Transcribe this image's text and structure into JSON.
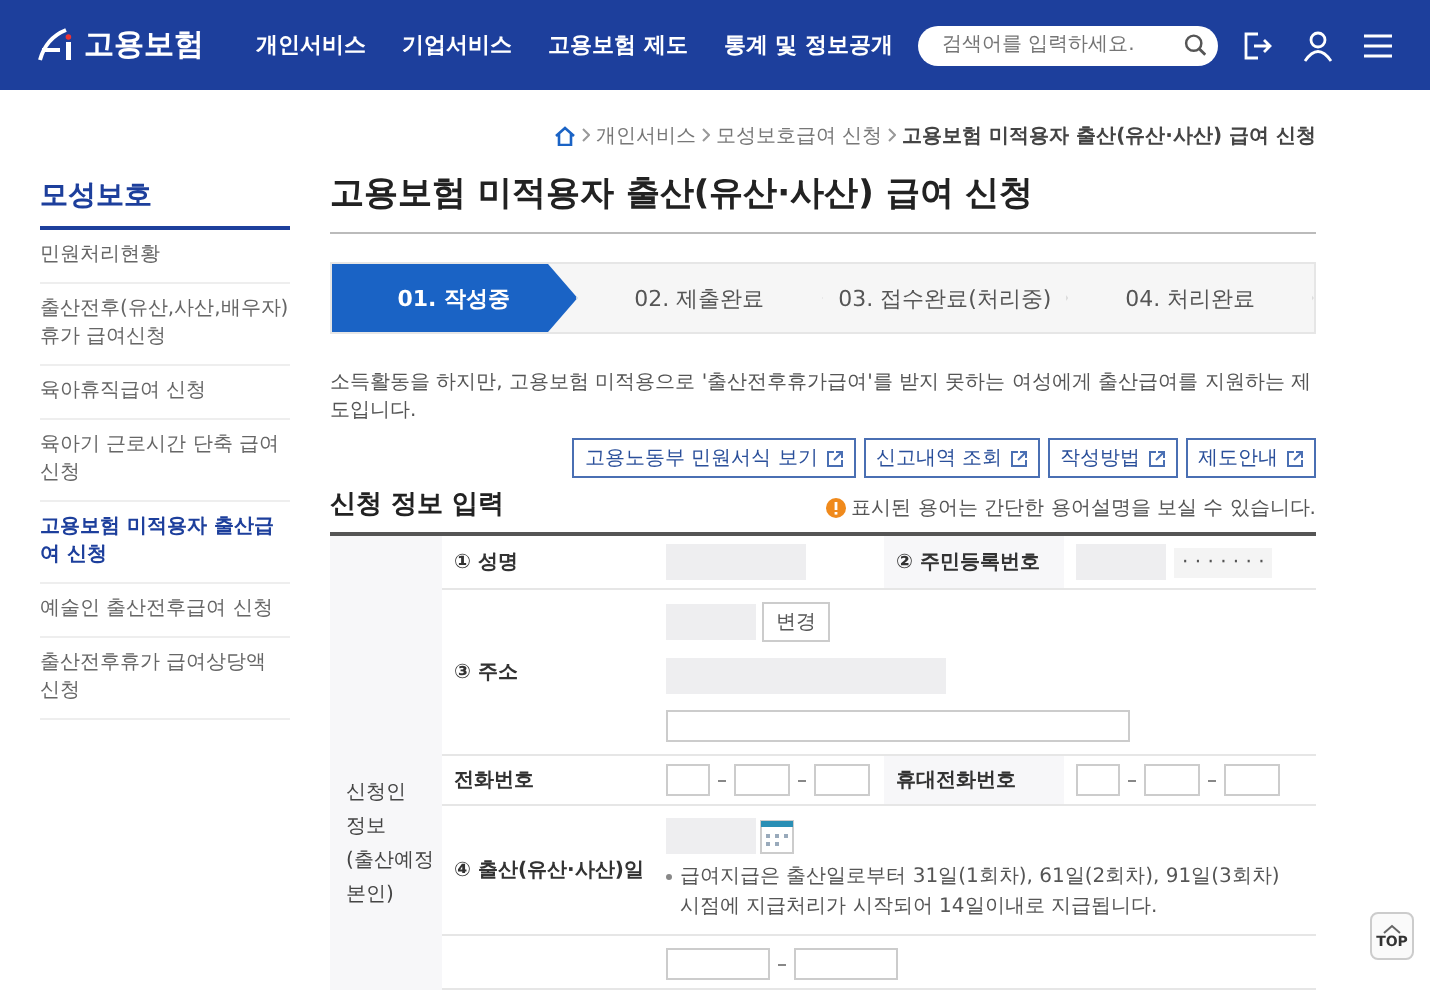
{
  "header": {
    "logo_text": "고용보험",
    "nav": [
      "개인서비스",
      "기업서비스",
      "고용보험 제도",
      "통계 및 정보공개"
    ],
    "search": {
      "placeholder": "검색어를 입력하세요."
    }
  },
  "breadcrumb": [
    "개인서비스",
    "모성보호급여 신청",
    "고용보험 미적용자 출산(유산·사산) 급여 신청"
  ],
  "sidebar": {
    "title": "모성보호",
    "items": [
      {
        "label": "민원처리현황",
        "selected": false
      },
      {
        "label": "출산전후(유산,사산,배우자)휴가 급여신청",
        "selected": false
      },
      {
        "label": "육아휴직급여 신청",
        "selected": false
      },
      {
        "label": "육아기 근로시간 단축 급여신청",
        "selected": false
      },
      {
        "label": "고용보험 미적용자 출산급여 신청",
        "selected": true
      },
      {
        "label": "예술인 출산전후급여 신청",
        "selected": false
      },
      {
        "label": "출산전후휴가 급여상당액 신청",
        "selected": false
      }
    ]
  },
  "page_title": "고용보험 미적용자 출산(유산·사산) 급여 신청",
  "steps": [
    {
      "label": "01. 작성중",
      "selected": true
    },
    {
      "label": "02. 제출완료",
      "selected": false
    },
    {
      "label": "03. 접수완료(처리중)",
      "selected": false
    },
    {
      "label": "04. 처리완료",
      "selected": false
    }
  ],
  "description": "소득활동을 하지만, 고용보험 미적용으로 '출산전후휴가급여'를 받지 못하는 여성에게 출산급여를 지원하는 제도입니다.",
  "link_buttons": [
    "고용노동부 민원서식 보기",
    "신고내역 조회",
    "작성방법",
    "제도안내"
  ],
  "section_title": "신청 정보 입력",
  "notice": "표시된 용어는 간단한 용어설명을 보실 수 있습니다.",
  "form": {
    "group_label": "신청인 정보 (출산예정 본인)",
    "name_label": "① 성명",
    "rrn_label": "② 주민등록번호",
    "rrn_mask": "· · · · · · ·",
    "address_label": "③ 주소",
    "change_button": "변경",
    "phone_label": "전화번호",
    "mobile_label": "휴대전화번호",
    "birth_label": "④ 출산(유산·사산)일",
    "birth_note": "급여지급은 출산일로부터 31일(1회차), 61일(2회차), 91일(3회차) 시점에 지급처리가 시작되어 14일이내로 지급됩니다."
  },
  "top_button": "TOP"
}
